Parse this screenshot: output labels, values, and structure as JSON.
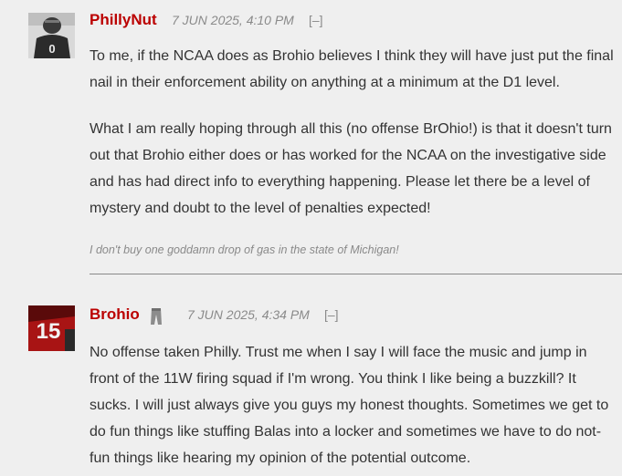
{
  "comments": [
    {
      "author": "PhillyNut",
      "timestamp": "7 JUN 2025, 4:10 PM",
      "collapse_label": "[–]",
      "avatar_icon": "helmet-jersey-avatar",
      "paragraphs": [
        "To me, if the NCAA does as Brohio believes I think they will have just put the final nail in their enforcement ability on anything at a minimum at the D1 level.",
        "What I am really hoping through all this (no offense BrOhio!) is that it doesn't turn out that Brohio either does or has worked for the NCAA on the investigative side and has had direct info to everything happening. Please let there be a level of mystery and doubt to the level of penalties expected!"
      ],
      "signature": "I don't buy one goddamn drop of gas in the state of Michigan!"
    },
    {
      "author": "Brohio",
      "timestamp": "7 JUN 2025, 4:34 PM",
      "collapse_label": "[–]",
      "avatar_icon": "jersey-15-avatar",
      "badge_icon": "pants-icon",
      "paragraphs": [
        "No offense taken Philly. Trust me when I say I will face the music and jump in front of the 11W firing squad if I'm wrong. You think I like being a buzzkill? It sucks. I will just always give you guys my honest thoughts. Sometimes we get to do fun things like stuffing Balas into a locker and sometimes we have to do not-fun things like hearing my opinion of the potential outcome."
      ]
    }
  ],
  "colors": {
    "author": "#bb0000",
    "meta": "#8a8a8a",
    "background": "#efefef",
    "text": "#333333"
  }
}
